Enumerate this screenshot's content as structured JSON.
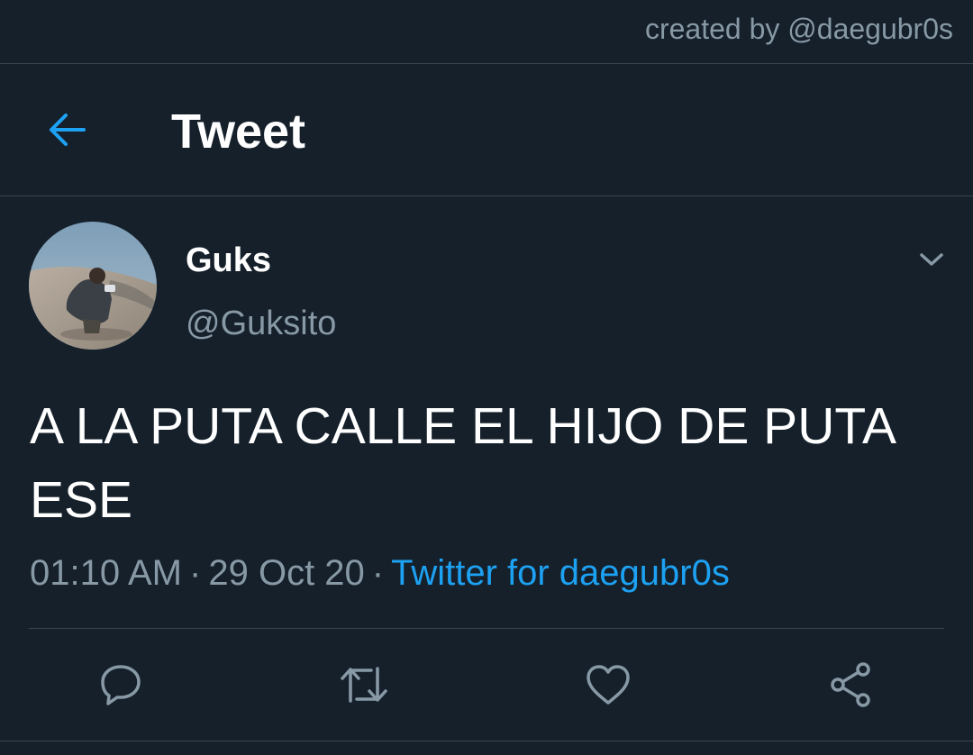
{
  "credit": "created by @daegubr0s",
  "header": {
    "title": "Tweet",
    "back_icon": "arrow-left-icon"
  },
  "tweet": {
    "author": {
      "display_name": "Guks",
      "handle": "@Guksito"
    },
    "text": "A LA PUTA CALLE EL HIJO DE PUTA ESE",
    "time": "01:10 AM",
    "date": "29 Oct 20",
    "separator": "·",
    "source": "Twitter for daegubr0s",
    "more_icon": "chevron-down-icon"
  },
  "actions": {
    "reply_icon": "reply-icon",
    "retweet_icon": "retweet-icon",
    "like_icon": "heart-icon",
    "share_icon": "share-icon"
  },
  "colors": {
    "background": "#15202b",
    "accent": "#1da1f2",
    "secondary_text": "#8899a6",
    "border": "#38444d"
  }
}
